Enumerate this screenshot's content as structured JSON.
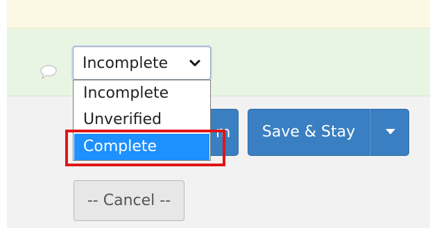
{
  "form": {
    "status_select": {
      "selected": "Incomplete",
      "options": [
        "Incomplete",
        "Unverified",
        "Complete"
      ],
      "highlighted_option": "Complete"
    },
    "buttons": {
      "hidden_fragment": "m",
      "save_stay": "Save & Stay",
      "cancel": "-- Cancel --"
    },
    "icons": {
      "comment": "comment-bubble-icon",
      "chevron": "chevron-down-icon",
      "caret": "caret-down-icon"
    }
  },
  "colors": {
    "top_band": "#fcf8e3",
    "green_band": "#e8f5e3",
    "primary_button": "#3a7fc1",
    "selected_option": "#1e90ff",
    "highlight_box": "#e01515"
  }
}
